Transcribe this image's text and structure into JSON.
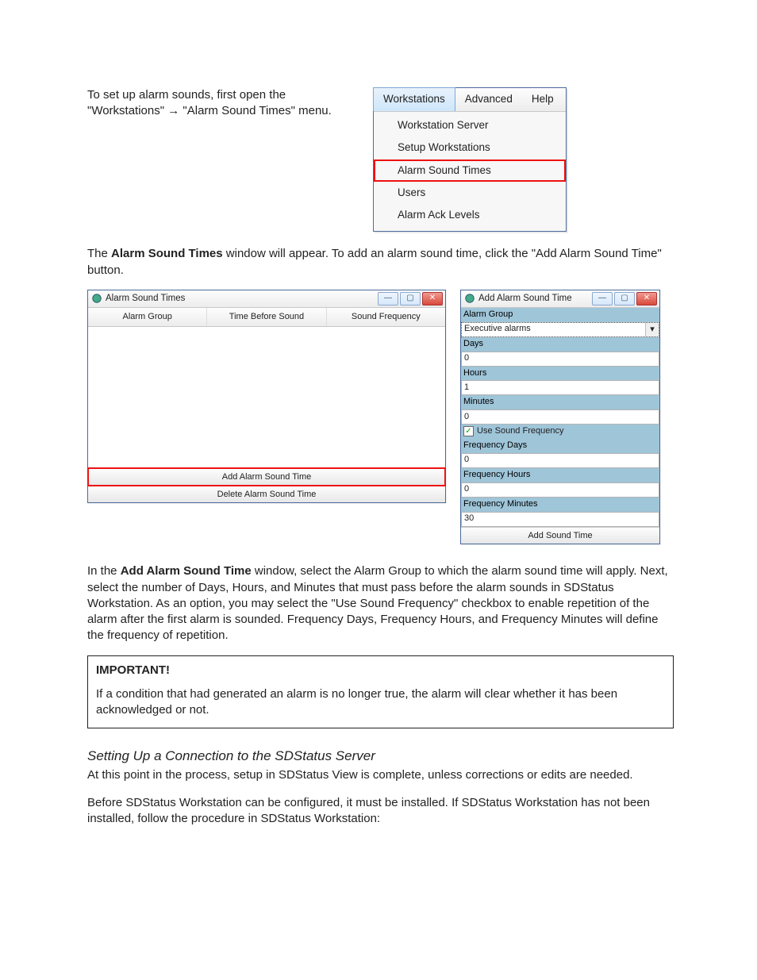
{
  "intro": {
    "p1_a": "To set up alarm sounds, first open the \"Workstations\" ",
    "arrow": "→",
    "p1_b": " \"Alarm Sound Times\" menu."
  },
  "menu": {
    "tabs": [
      "Workstations",
      "Advanced",
      "Help"
    ],
    "items": [
      "Workstation Server",
      "Setup Workstations",
      "Alarm Sound Times",
      "Users",
      "Alarm Ack Levels"
    ]
  },
  "p2_a": "The ",
  "p2_bold": "Alarm Sound Times",
  "p2_b": " window will appear. To add an alarm sound time, click the \"Add Alarm Sound Time\" button.",
  "ast": {
    "title": "Alarm Sound Times",
    "cols": [
      "Alarm Group",
      "Time Before Sound",
      "Sound Frequency"
    ],
    "add_btn": "Add Alarm Sound Time",
    "del_btn": "Delete Alarm Sound Time"
  },
  "add": {
    "title": "Add Alarm Sound Time",
    "fields": {
      "alarm_group_lbl": "Alarm Group",
      "alarm_group_val": "Executive alarms",
      "days_lbl": "Days",
      "days_val": "0",
      "hours_lbl": "Hours",
      "hours_val": "1",
      "minutes_lbl": "Minutes",
      "minutes_val": "0",
      "use_freq": "Use Sound Frequency",
      "freq_days_lbl": "Frequency Days",
      "freq_days_val": "0",
      "freq_hours_lbl": "Frequency Hours",
      "freq_hours_val": "0",
      "freq_min_lbl": "Frequency Minutes",
      "freq_min_val": "30"
    },
    "btn": "Add Sound Time"
  },
  "p3_a": "In the ",
  "p3_bold": "Add Alarm Sound Time",
  "p3_b": " window, select the Alarm Group to which the alarm sound time will apply. Next, select the number of Days, Hours, and Minutes that must pass before the alarm sounds in SDStatus Workstation. As an option, you may select the \"Use Sound Frequency\" checkbox to enable repetition of the alarm after the first alarm is sounded. Frequency Days, Frequency Hours, and Frequency Minutes will define the frequency of repetition.",
  "important": {
    "hdr": "IMPORTANT!",
    "body": "If a condition that had generated an alarm is no longer true, the alarm will clear whether it has been acknowledged or not."
  },
  "h3": "Setting Up a Connection to the SDStatus Server",
  "p4": "At this point in the process, setup in SDStatus View is complete, unless corrections or edits are needed.",
  "p5": "Before SDStatus Workstation can be configured, it must be installed. If SDStatus Workstation has not been installed, follow the procedure in SDStatus Workstation:"
}
